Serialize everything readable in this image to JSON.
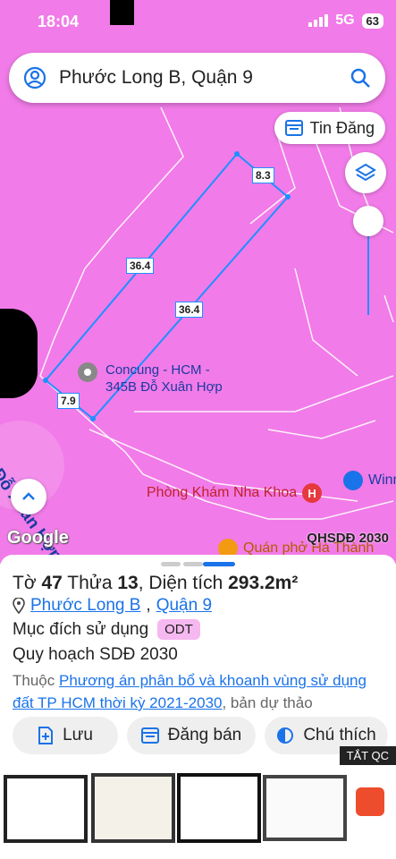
{
  "status": {
    "time": "18:04",
    "network": "5G",
    "battery": "63"
  },
  "search": {
    "text": "Phước Long B, Quận 9"
  },
  "chip_post": {
    "label": "Tin Đăng"
  },
  "map": {
    "dims": [
      "8.3",
      "36.4",
      "36.4",
      "7.9"
    ],
    "poi_concung": "Concung - HCM - 345B Đỗ Xuân Hợp",
    "poi_clinic": "Phòng Khám Nha Khoa",
    "poi_win": "Winm",
    "poi_pho": "Quán phở Hà Thành",
    "street": "Đ. Đỗ Xuân Hợp",
    "google": "Google",
    "layer": "QHSDĐ 2030"
  },
  "sheet": {
    "to_label": "Tờ",
    "to_value": "47",
    "thua_label": "Thửa",
    "thua_value": "13",
    "area_label": "Diện tích",
    "area_value": "293.2m²",
    "ward": "Phước Long B",
    "district": "Quận 9",
    "purpose_label": "Mục đích sử dụng",
    "purpose_code": "ODT",
    "plan_label": "Quy hoạch SDĐ 2030",
    "belongs_prefix": "Thuộc",
    "plan_link": "Phương án phân bổ và khoanh vùng sử dụng đất TP HCM thời kỳ 2021-2030",
    "belongs_suffix": ", bản dự thảo",
    "btn_save": "Lưu",
    "btn_sell": "Đăng bán",
    "btn_note": "Chú thích"
  },
  "ad": {
    "close_label": "TẮT QC"
  },
  "colors": {
    "map_bg": "#f17be8",
    "accent": "#1a73e8",
    "parcel_line": "#1e90ff",
    "badge": "#f6b8f0"
  }
}
